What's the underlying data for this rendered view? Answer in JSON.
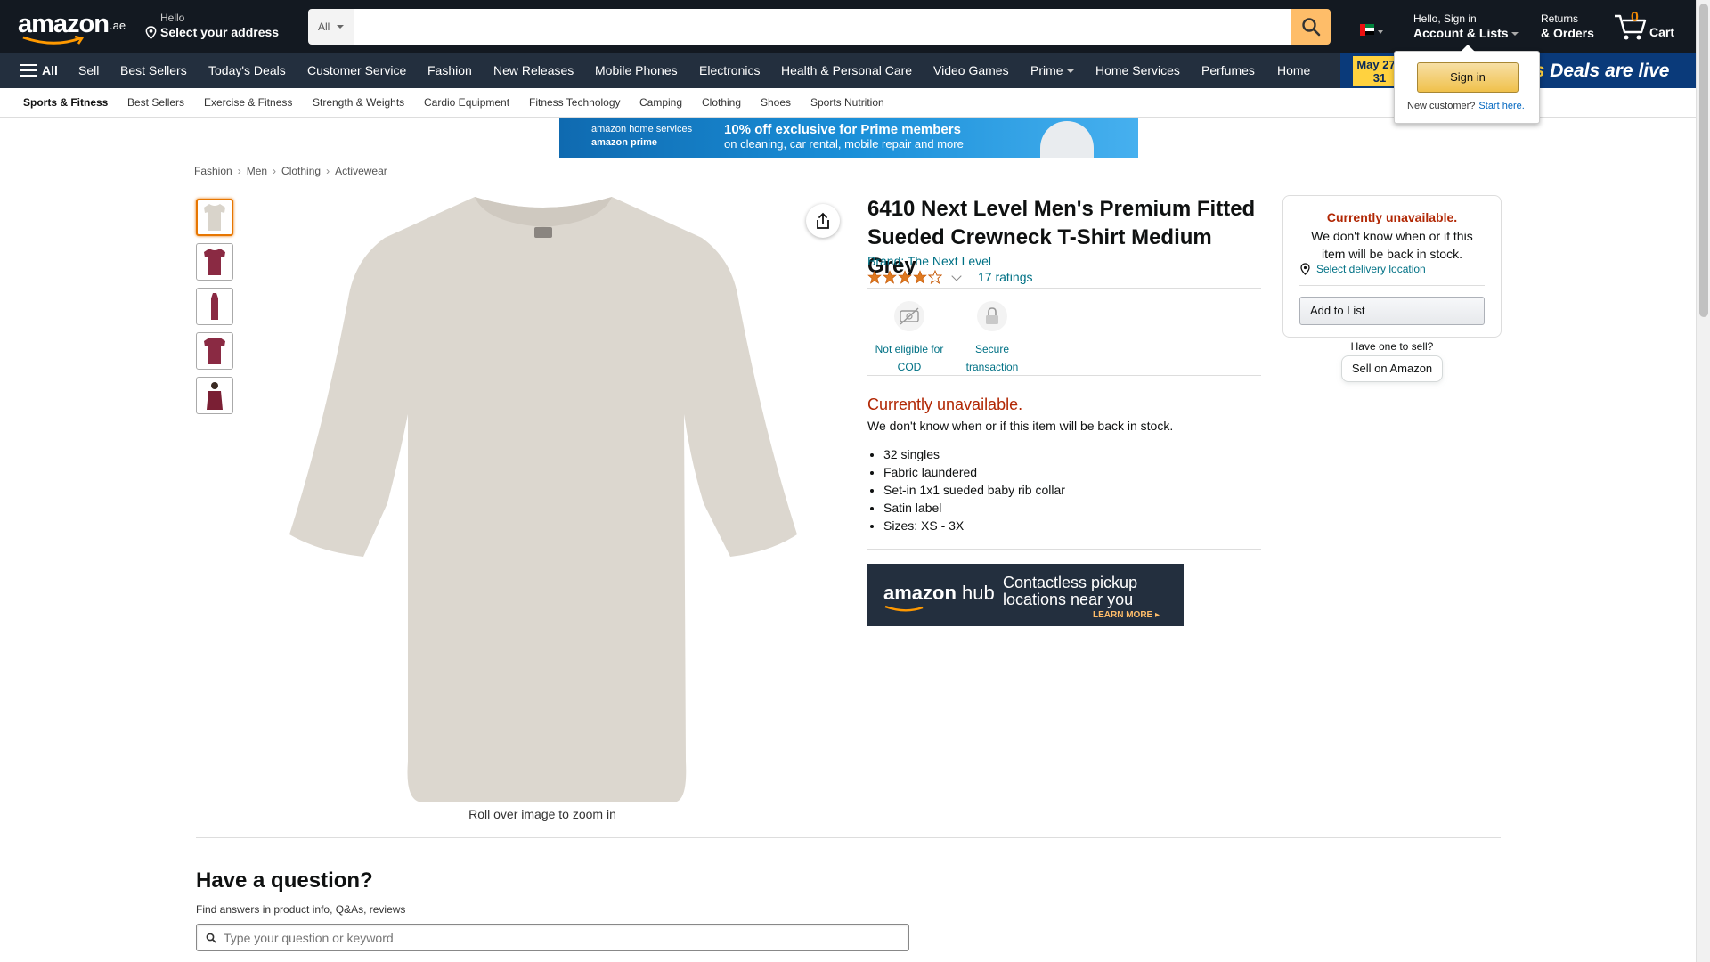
{
  "header": {
    "logo_text": "amazon",
    "logo_tld": ".ae",
    "address_line1": "Hello",
    "address_line2": "Select your address",
    "search_category": "All",
    "search_placeholder": "",
    "account_line1": "Hello, Sign in",
    "account_line2": "Account & Lists",
    "orders_line1": "Returns",
    "orders_line2": "& Orders",
    "cart_count": "0",
    "cart_label": "Cart"
  },
  "nav": {
    "all_label": "All",
    "items": [
      "Sell",
      "Best Sellers",
      "Today's Deals",
      "Customer Service",
      "Fashion",
      "New Releases",
      "Mobile Phones",
      "Electronics",
      "Health & Personal Care",
      "Video Games",
      "Prime",
      "Home Services",
      "Perfumes",
      "Home"
    ],
    "banner_date": "May 27 - 31",
    "banner_text_accent": "ys",
    "banner_text": "Deals are live"
  },
  "subnav": {
    "items": [
      "Sports & Fitness",
      "Best Sellers",
      "Exercise & Fitness",
      "Strength & Weights",
      "Cardio Equipment",
      "Fitness Technology",
      "Camping",
      "Clothing",
      "Shoes",
      "Sports Nutrition"
    ]
  },
  "flyout": {
    "signin_label": "Sign in",
    "new_customer": "New customer?",
    "start_here": "Start here."
  },
  "promo": {
    "brand_line1": "amazon home services",
    "brand_line2": "amazon prime",
    "offer_line1": "10% off exclusive for Prime members",
    "offer_line2": "on cleaning, car rental, mobile repair and more"
  },
  "breadcrumb": [
    "Fashion",
    "Men",
    "Clothing",
    "Activewear"
  ],
  "gallery": {
    "thumb_colors": [
      "#d9d4cb",
      "#8a2a43",
      "#8a2a43",
      "#8a2a43",
      "#7a1f34"
    ],
    "main_color": "#dcd7cf",
    "zoom_hint": "Roll over image to zoom in"
  },
  "product": {
    "title": "6410 Next Level Men's Premium Fitted Sueded Crewneck T-Shirt Medium Grey",
    "brand": "Brand: The Next Level",
    "rating_stars": 4.0,
    "ratings_count": "17 ratings",
    "features": [
      {
        "label": "Not eligible for COD",
        "icon": "no-cod-icon"
      },
      {
        "label": "Secure transaction",
        "icon": "lock-icon"
      }
    ],
    "availability": "Currently unavailable.",
    "availability_sub": "We don't know when or if this item will be back in stock.",
    "bullets": [
      "32 singles",
      "Fabric laundered",
      "Set-in 1x1 sueded baby rib collar",
      "Satin label",
      "Sizes: XS - 3X"
    ],
    "hub_brand": "amazon",
    "hub_sub": "hub",
    "hub_line1": "Contactless pickup",
    "hub_line2": "locations near you",
    "hub_cta": "LEARN MORE ▸"
  },
  "buybox": {
    "unavailable": "Currently unavailable.",
    "message": "We don't know when or if this item will be back in stock.",
    "location": "Select delivery location",
    "add_to_list": "Add to List",
    "have_one": "Have one to sell?",
    "sell_on_amazon": "Sell on Amazon"
  },
  "question": {
    "heading": "Have a question?",
    "sub": "Find answers in product info, Q&As, reviews",
    "placeholder": "Type your question or keyword"
  },
  "colors": {
    "header_bg": "#131921",
    "nav_bg": "#232f3e",
    "search_button": "#febd69",
    "link": "#007185",
    "unavailable": "#b12704",
    "star": "#de7921"
  }
}
